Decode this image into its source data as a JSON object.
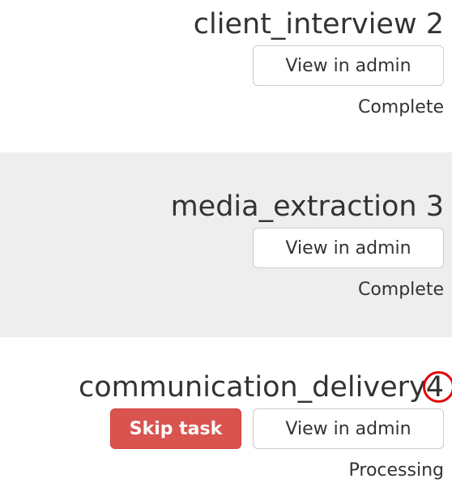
{
  "tasks": [
    {
      "name": "client_interview",
      "number": "2",
      "view_label": "View in admin",
      "status": "Complete"
    },
    {
      "name": "media_extraction",
      "number": "3",
      "view_label": "View in admin",
      "status": "Complete"
    },
    {
      "name": "communication_delivery",
      "number": "4",
      "skip_label": "Skip task",
      "view_label": "View in admin",
      "status": "Processing"
    }
  ],
  "colors": {
    "skip_button": "#d9534f",
    "highlight_circle": "#e60000",
    "alt_row_background": "#eeeeee"
  }
}
